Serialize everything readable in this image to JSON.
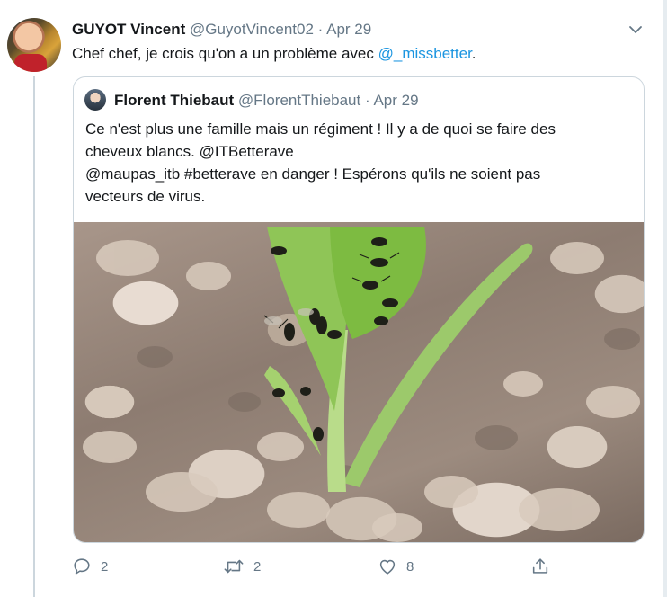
{
  "tweet": {
    "author_name": "GUYOT Vincent",
    "author_handle": "@GuyotVincent02",
    "separator": "·",
    "date": "Apr 29",
    "text_prefix": "Chef chef, je crois qu'on a un problème avec ",
    "mention": "@_missbetter",
    "text_suffix": "."
  },
  "quote": {
    "author_name": "Florent Thiebaut",
    "author_handle": "@FlorentThiebaut",
    "separator": "·",
    "date": "Apr 29",
    "text_lines": [
      "Ce n'est plus une famille mais un régiment ! Il y a de quoi se faire des",
      "cheveux blancs. @ITBetterave",
      "@maupas_itb #betterave en danger ! Espérons qu'ils ne soient pas",
      "vecteurs de virus."
    ]
  },
  "actions": {
    "reply_count": "2",
    "retweet_count": "2",
    "like_count": "8"
  },
  "icons": {
    "menu": "chevron-down-icon",
    "reply": "reply-icon",
    "retweet": "retweet-icon",
    "like": "heart-icon",
    "share": "share-icon"
  },
  "colors": {
    "link": "#1b95e0",
    "muted": "#657786",
    "text": "#14171a",
    "border": "#ccd6dd"
  }
}
